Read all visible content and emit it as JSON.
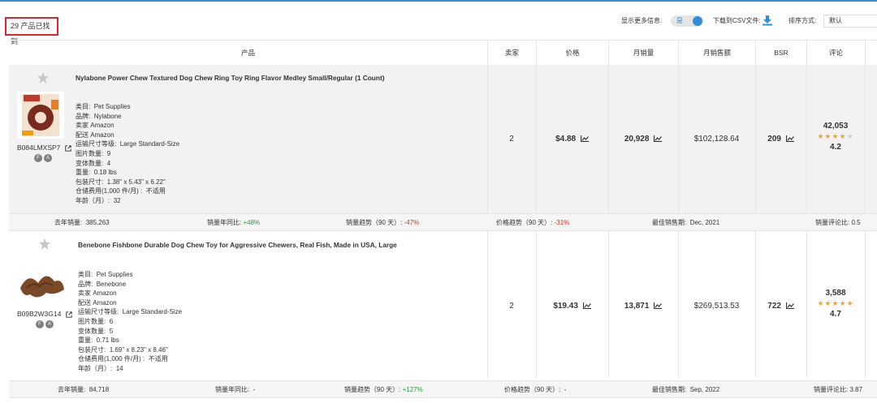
{
  "found_label": "29 产品已找到",
  "controls": {
    "show_more_label": "显示更多信息:",
    "toggle_value": "是",
    "download_label": "下载到CSV文件:",
    "sort_label": "排序方式:",
    "sort_value": "默认"
  },
  "columns": [
    "产品",
    "卖家",
    "价格",
    "月销量",
    "月销售额",
    "BSR",
    "评论"
  ],
  "attr_keys": {
    "category": "类目:",
    "brand": "品牌:",
    "seller": "卖家",
    "fulfillment": "配送",
    "size_tier": "运输尺寸等级:",
    "images": "图片数量:",
    "variants": "变体数量:",
    "weight": "重量:",
    "dimensions": "包装尺寸:",
    "storage_fee": "仓储费用",
    "age": "年龄（月）:"
  },
  "footer_keys": {
    "last_year_sales": "去年销量:",
    "yoy": "销量年同比:",
    "sales_trend": "销量趋势（90 天）:",
    "price_trend": "价格趋势（90 天）:",
    "best_period": "最佳销售期:",
    "review_ratio": "销量评论比:"
  },
  "products": [
    {
      "title": "Nylabone Power Chew Textured Dog Chew Ring Toy Ring Flavor Medley Small/Regular (1 Count)",
      "asin": "B084LMXSP7",
      "badges": [
        "F",
        "A"
      ],
      "category": "Pet Supplies",
      "brand": "Nylabone",
      "seller": "Amazon",
      "fulfillment": "Amazon",
      "size_tier": "Large Standard-Size",
      "images": "9",
      "variants": "4",
      "weight": "0.18 lbs",
      "dimensions": "1.38\" x 5.43\" x 6.22\"",
      "storage_fee_label": "(1,000 件/月) :",
      "storage_fee": "不适用",
      "age": "32",
      "sellers": "2",
      "price": "$4.88",
      "monthly_sales": "20,928",
      "monthly_revenue": "$102,128.64",
      "bsr": "209",
      "review_count": "42,053",
      "rating": "4.2",
      "stars_filled": 4,
      "last_year_sales": "385,263",
      "yoy": "+48%",
      "sales_trend": "-47%",
      "price_trend": "-31%",
      "best_period": "Dec, 2021",
      "review_ratio": "0.5"
    },
    {
      "title": "Benebone Fishbone Durable Dog Chew Toy for Aggressive Chewers, Real Fish, Made in USA, Large",
      "asin": "B09B2W3G14",
      "badges": [
        "F",
        "A"
      ],
      "category": "Pet Supplies",
      "brand": "Benebone",
      "seller": "Amazon",
      "fulfillment": "Amazon",
      "size_tier": "Large Standard-Size",
      "images": "6",
      "variants": "5",
      "weight": "0.71 lbs",
      "dimensions": "1.69\" x 8.23\" x 8.46\"",
      "storage_fee_label": "(1,000 件/月) :",
      "storage_fee": "不适用",
      "age": "14",
      "sellers": "2",
      "price": "$19.43",
      "monthly_sales": "13,871",
      "monthly_revenue": "$269,513.53",
      "bsr": "722",
      "review_count": "3,588",
      "rating": "4.7",
      "stars_filled": 5,
      "last_year_sales": "84,718",
      "yoy": "-",
      "sales_trend": "+127%",
      "price_trend": "-",
      "best_period": "Sep, 2022",
      "review_ratio": "3.87"
    }
  ]
}
